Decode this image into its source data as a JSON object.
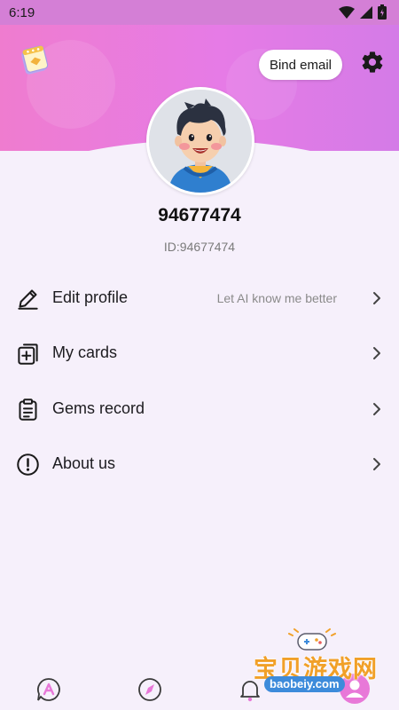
{
  "status_bar": {
    "time": "6:19"
  },
  "header": {
    "bind_email_label": "Bind email"
  },
  "profile": {
    "username": "94677474",
    "id_text": "ID:94677474"
  },
  "menu": [
    {
      "label": "Edit profile",
      "hint": "Let AI know me better",
      "icon": "edit-pencil-icon"
    },
    {
      "label": "My cards",
      "hint": "",
      "icon": "cards-icon"
    },
    {
      "label": "Gems record",
      "hint": "",
      "icon": "clipboard-icon"
    },
    {
      "label": "About us",
      "hint": "",
      "icon": "info-exclamation-icon"
    }
  ],
  "bottom_nav": [
    "ai-chat-icon",
    "compass-icon",
    "bell-icon",
    "profile-icon"
  ],
  "watermark": {
    "title": "宝贝游戏网",
    "url": "baobeiy.com"
  },
  "colors": {
    "header_start": "#ef7ccf",
    "header_end": "#d47be7",
    "page_bg": "#f6f0fb",
    "accent": "#e878d8"
  }
}
